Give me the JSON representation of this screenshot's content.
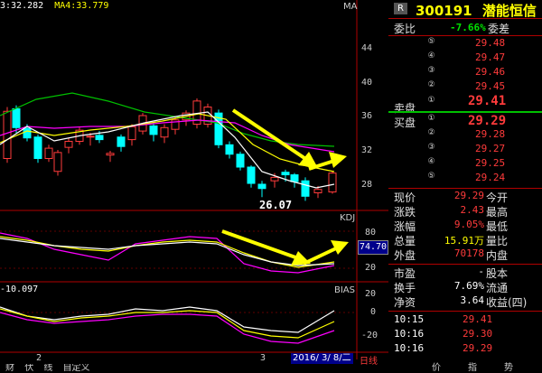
{
  "chart": {
    "ma_values": [
      {
        "text": "3:32.282",
        "color": "#ffffff"
      },
      {
        "text": "MA4:33.779",
        "color": "#ffff00"
      }
    ],
    "ma_tag": "MA",
    "price_axis": [
      "44",
      "40",
      "36",
      "32",
      "28"
    ],
    "low_label": "26.07",
    "kdj_label": "KDJ",
    "kdj_axis": [
      "80",
      "20"
    ],
    "kdj_value": "74.70",
    "bias_value": "-10.097",
    "bias_label": "BIAS",
    "bias_axis": [
      "20",
      "0",
      "-20"
    ],
    "x_labels": [
      "2",
      "3"
    ],
    "date_label": "2016/ 3/ 8/二",
    "date_period": "日线",
    "bottom_tabs": [
      "财",
      "伏",
      "线",
      "自定义"
    ],
    "colors": {
      "up": "#ff3b3b",
      "down": "#00ffff",
      "ma5": "#ffffff",
      "ma10": "#ffff00",
      "ma20": "#ff00ff",
      "ma60": "#00c000",
      "arrow": "#ffff00"
    }
  },
  "panel": {
    "badge": "R",
    "code": "300191",
    "name": "潜能恒信",
    "commission_label": "委比",
    "commission_value": "-7.66%",
    "commission_diff_label": "委差",
    "sell_label": "卖盘",
    "buy_label": "买盘",
    "asks": [
      {
        "level": "⑤",
        "price": "29.48"
      },
      {
        "level": "④",
        "price": "29.47"
      },
      {
        "level": "③",
        "price": "29.46"
      },
      {
        "level": "②",
        "price": "29.45"
      },
      {
        "level": "①",
        "price": "29.41"
      }
    ],
    "bids": [
      {
        "level": "①",
        "price": "29.29"
      },
      {
        "level": "②",
        "price": "29.28"
      },
      {
        "level": "③",
        "price": "29.27"
      },
      {
        "level": "④",
        "price": "29.25"
      },
      {
        "level": "⑤",
        "price": "29.24"
      }
    ],
    "stats": [
      {
        "l1": "现价",
        "v1": "29.29",
        "c1": "#ff3b3b",
        "l2": "今开",
        "v2": ""
      },
      {
        "l1": "涨跌",
        "v1": "2.43",
        "c1": "#ff3b3b",
        "l2": "最高",
        "v2": ""
      },
      {
        "l1": "涨幅",
        "v1": "9.05%",
        "c1": "#ff3b3b",
        "l2": "最低",
        "v2": ""
      },
      {
        "l1": "总量",
        "v1": "15.91万",
        "c1": "#ffff00",
        "l2": "量比",
        "v2": ""
      },
      {
        "l1": "外盘",
        "v1": "70178",
        "c1": "#ff3b3b",
        "l2": "内盘",
        "v2": ""
      }
    ],
    "stats2": [
      {
        "l1": "市盈",
        "v1": "-",
        "l2": "股本"
      },
      {
        "l1": "换手",
        "v1": "7.69%",
        "l2": "流通"
      },
      {
        "l1": "净资",
        "v1": "3.64",
        "l2": "收益(四)"
      }
    ],
    "trades": [
      {
        "time": "10:15",
        "price": "29.41"
      },
      {
        "time": "10:16",
        "price": "29.30"
      },
      {
        "time": "10:16",
        "price": "29.29"
      }
    ],
    "bottom_tabs": [
      "价",
      "指",
      "势"
    ]
  }
}
